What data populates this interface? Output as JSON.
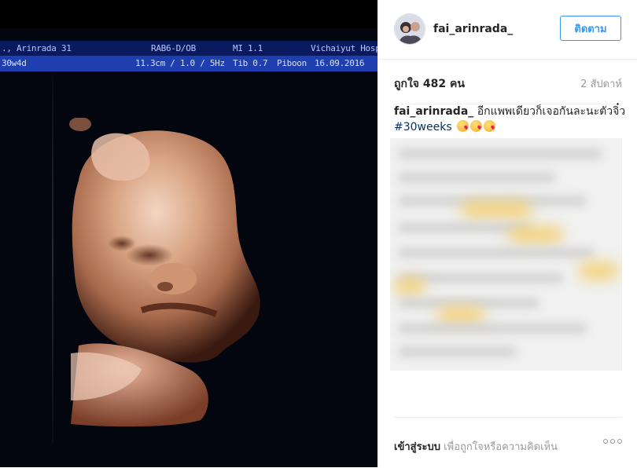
{
  "photo": {
    "row1": {
      "patient": "., Arinrada  31",
      "probe": "RAB6-D/OB",
      "mi": "MI  1.1",
      "hospital": "Vichaiyut Hosp"
    },
    "row2": {
      "ga": "30w4d",
      "depth": "11.3cm / 1.0 / 5Hz",
      "tib": "Tib  0.7",
      "operator": "Piboon",
      "date": "16.09.2016"
    },
    "colors": {
      "header_dark": "#0a1a5e",
      "header_light": "#1f3fb0",
      "skin": "#c98a68"
    }
  },
  "post": {
    "username": "fai_arinrada_",
    "follow_label": "ติดตาม",
    "likes": "ถูกใจ 482 คน",
    "time": "2 สัปดาห์",
    "caption_user": "fai_arinrada_",
    "caption_text": "อีกแพพเดียวก็เจอกันละนะตัวจิ๋ว",
    "hashtag": "#30weeks",
    "login_link": "เข้าสู่ระบบ",
    "login_text": "เพื่อถูกใจหรือความคิดเห็น",
    "accent_color": "#3897f0"
  }
}
